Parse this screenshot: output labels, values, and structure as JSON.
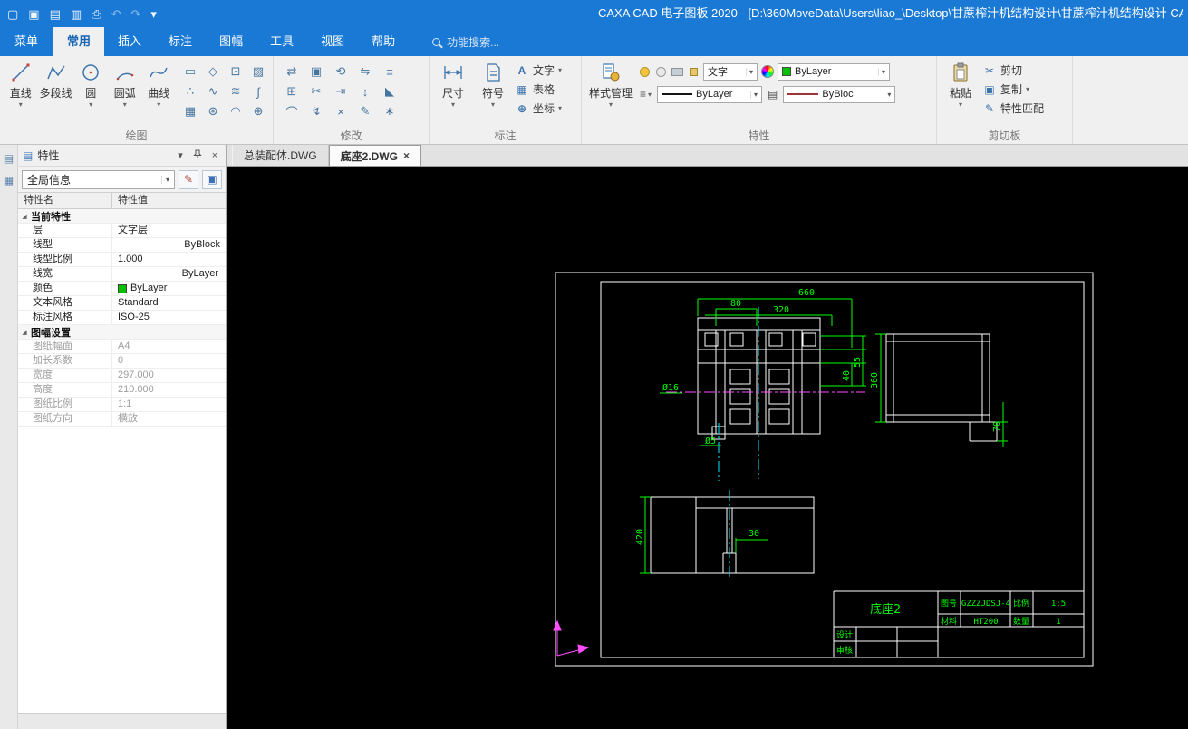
{
  "window": {
    "title": "CAXA CAD 电子图板 2020 - [D:\\360MoveData\\Users\\liao_\\Desktop\\甘蔗榨汁机结构设计\\甘蔗榨汁机结构设计 CAD图纸",
    "accent": "#1a79d5"
  },
  "ui": {
    "dropdown_arrow": "▾",
    "close": "×",
    "expander": "◢"
  },
  "quick_access": [
    {
      "name": "new-file-icon",
      "glyph": "▢"
    },
    {
      "name": "open-file-icon",
      "glyph": "▣"
    },
    {
      "name": "save-icon",
      "glyph": "▤"
    },
    {
      "name": "save-all-icon",
      "glyph": "▥"
    },
    {
      "name": "print-icon",
      "glyph": "⎙"
    },
    {
      "name": "undo-icon",
      "glyph": "↶"
    },
    {
      "name": "redo-icon",
      "glyph": "↷"
    },
    {
      "name": "customize-icon",
      "glyph": "▾"
    }
  ],
  "menubar": {
    "menu_label": "菜单",
    "tabs": [
      "常用",
      "插入",
      "标注",
      "图幅",
      "工具",
      "视图",
      "帮助"
    ],
    "active_tab": "常用",
    "search_placeholder": "功能搜索..."
  },
  "ribbon": {
    "draw": {
      "label": "绘图",
      "big": [
        {
          "label": "直线",
          "arrow": "▾"
        },
        {
          "label": "多段线",
          "arrow": ""
        },
        {
          "label": "圆",
          "arrow": "▾"
        },
        {
          "label": "圆弧",
          "arrow": "▾"
        },
        {
          "label": "曲线",
          "arrow": "▾"
        }
      ],
      "small": [
        {
          "name": "rectangle-icon",
          "glyph": "▭"
        },
        {
          "name": "polygon-icon",
          "glyph": "◇"
        },
        {
          "name": "center-rectangle-icon",
          "glyph": "⊡"
        },
        {
          "name": "hatch-icon",
          "glyph": "▨"
        },
        {
          "name": "point-icon",
          "glyph": "∴"
        },
        {
          "name": "wave-line-icon",
          "glyph": "∿"
        },
        {
          "name": "double-line-icon",
          "glyph": "≋"
        },
        {
          "name": "formula-curve-icon",
          "glyph": "∫"
        },
        {
          "name": "fill-icon",
          "glyph": "▦"
        },
        {
          "name": "gear-icon",
          "glyph": "⊛"
        },
        {
          "name": "arc-3p-icon",
          "glyph": "◠"
        },
        {
          "name": "axis-icon",
          "glyph": "⊕"
        }
      ]
    },
    "modify": {
      "label": "修改",
      "small": [
        {
          "name": "translate-icon",
          "glyph": "⇄"
        },
        {
          "name": "copy-entity-icon",
          "glyph": "▣"
        },
        {
          "name": "rotate-icon",
          "glyph": "⟲"
        },
        {
          "name": "mirror-icon",
          "glyph": "⇋"
        },
        {
          "name": "offset-icon",
          "glyph": "≡"
        },
        {
          "name": "array-icon",
          "glyph": "⊞"
        },
        {
          "name": "trim-icon",
          "glyph": "✂"
        },
        {
          "name": "extend-icon",
          "glyph": "⇥"
        },
        {
          "name": "stretch-icon",
          "glyph": "↕"
        },
        {
          "name": "chamfer-icon",
          "glyph": "◣"
        },
        {
          "name": "fillet-icon",
          "glyph": "⌒"
        },
        {
          "name": "break-icon",
          "glyph": "↯"
        },
        {
          "name": "erase-icon",
          "glyph": "×"
        },
        {
          "name": "edit-icon",
          "glyph": "✎"
        },
        {
          "name": "explode-icon",
          "glyph": "∗"
        }
      ]
    },
    "dimension": {
      "label": "标注",
      "big": [
        {
          "label": "尺寸",
          "arrow": "▾"
        },
        {
          "label": "符号",
          "arrow": "▾"
        }
      ],
      "stack": [
        {
          "label": "文字",
          "arrow": "▾",
          "icon_glyph": "A"
        },
        {
          "label": "表格",
          "arrow": "",
          "icon_glyph": "▦"
        },
        {
          "label": "坐标",
          "arrow": "▾",
          "icon_glyph": "⊕"
        }
      ]
    },
    "properties": {
      "label": "特性",
      "style_manager": "样式管理",
      "layer_value": "文字",
      "color_value": "ByLayer",
      "color_swatch": "#00c000",
      "linetype_value": "ByLayer",
      "lineweight_value": "ByBloc",
      "lineweight_color": "#a03434",
      "linetype_icon_glyph": "≡",
      "lineweight_icon_glyph": "▤"
    },
    "clipboard": {
      "label": "剪切板",
      "paste_label": "粘贴",
      "paste_arrow": "▾",
      "items": [
        {
          "label": "剪切",
          "glyph": "✂",
          "arrow": ""
        },
        {
          "label": "复制",
          "glyph": "▣",
          "arrow": "▾"
        },
        {
          "label": "特性匹配",
          "glyph": "✎",
          "arrow": ""
        }
      ]
    }
  },
  "side_strip": [
    {
      "name": "properties-tab-icon",
      "glyph": "▤"
    },
    {
      "name": "library-tab-icon",
      "glyph": "▦"
    }
  ],
  "properties_panel": {
    "title": "特性",
    "scope_combo": "全局信息",
    "col_name": "特性名",
    "col_value": "特性值",
    "rows": [
      {
        "kind": "section",
        "name": "当前特性",
        "value": ""
      },
      {
        "kind": "item",
        "name": "层",
        "value": "文字层"
      },
      {
        "kind": "line",
        "name": "线型",
        "value": "ByBlock"
      },
      {
        "kind": "item",
        "name": "线型比例",
        "value": "1.000"
      },
      {
        "kind": "right",
        "name": "线宽",
        "value": "ByLayer"
      },
      {
        "kind": "swatch",
        "name": "颜色",
        "value": "ByLayer",
        "swatch": "#00c000"
      },
      {
        "kind": "item",
        "name": "文本风格",
        "value": "Standard"
      },
      {
        "kind": "item",
        "name": "标注风格",
        "value": "ISO-25"
      },
      {
        "kind": "section",
        "name": "图幅设置",
        "value": ""
      },
      {
        "kind": "disabled",
        "name": "图纸幅面",
        "value": "A4"
      },
      {
        "kind": "disabled",
        "name": "加长系数",
        "value": "0"
      },
      {
        "kind": "disabled",
        "name": "宽度",
        "value": "297.000"
      },
      {
        "kind": "disabled",
        "name": "高度",
        "value": "210.000"
      },
      {
        "kind": "disabled",
        "name": "图纸比例",
        "value": "1:1"
      },
      {
        "kind": "disabled",
        "name": "图纸方向",
        "value": "横放"
      }
    ]
  },
  "document_tabs": [
    {
      "label": "总装配体.DWG",
      "active": false
    },
    {
      "label": "底座2.DWG",
      "active": true,
      "close": "×"
    }
  ],
  "drawing": {
    "title_block": {
      "part_name": "底座2",
      "no_label": "图号",
      "no_value": "GZZZJDSJ-4",
      "scale_label": "比例",
      "scale_value": "1:5",
      "material_label": "材料",
      "material_value": "HT200",
      "qty_label": "数量",
      "qty_value": "1",
      "design_label": "设计",
      "check_label": "审核"
    },
    "dims": {
      "d660": "660",
      "d80": "80",
      "d320": "320",
      "d40": "40",
      "d55": "55",
      "d16": "Ø16",
      "d5": "Ø5",
      "d360": "360",
      "d70": "70",
      "d420": "420",
      "d30": "30"
    },
    "colors": {
      "geometry": "#ffffff",
      "dimension": "#00ff00",
      "centerline_magenta": "#ff4dff",
      "centerline_cyan": "#00e5ff"
    }
  }
}
